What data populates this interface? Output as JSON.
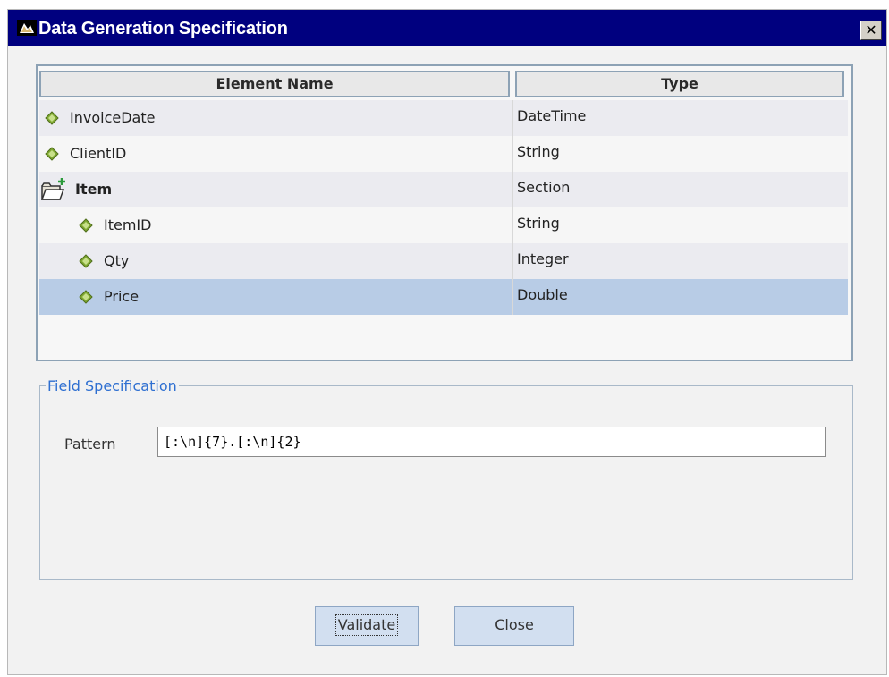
{
  "window": {
    "title": "Data Generation Specification",
    "close_glyph": "✕"
  },
  "grid": {
    "columns": [
      "Element Name",
      "Type"
    ],
    "rows": [
      {
        "name": "InvoiceDate",
        "type": "DateTime",
        "icon": "diamond-icon",
        "indent": 0,
        "bold": false,
        "selected": false
      },
      {
        "name": "ClientID",
        "type": "String",
        "icon": "diamond-icon",
        "indent": 0,
        "bold": false,
        "selected": false
      },
      {
        "name": "Item",
        "type": "Section",
        "icon": "section-folder-icon",
        "indent": 0,
        "bold": true,
        "selected": false
      },
      {
        "name": "ItemID",
        "type": "String",
        "icon": "diamond-icon",
        "indent": 1,
        "bold": false,
        "selected": false
      },
      {
        "name": "Qty",
        "type": "Integer",
        "icon": "diamond-icon",
        "indent": 1,
        "bold": false,
        "selected": false
      },
      {
        "name": "Price",
        "type": "Double",
        "icon": "diamond-icon",
        "indent": 1,
        "bold": false,
        "selected": true
      }
    ]
  },
  "field_spec": {
    "legend": "Field Specification",
    "pattern_label": "Pattern",
    "pattern_value": "[:\\n]{7}.[:\\n]{2}"
  },
  "buttons": {
    "validate": "Validate",
    "close": "Close"
  },
  "colors": {
    "titlebar": "#00007f",
    "selection": "#b8cce6",
    "legend_text": "#2e6fd1",
    "diamond": "#7fa832"
  }
}
